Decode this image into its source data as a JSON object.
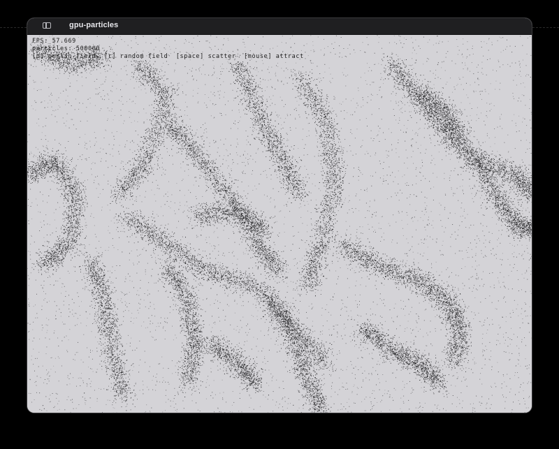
{
  "window": {
    "title": "gpu-particles",
    "sidebar_icon": "sidebar-toggle-icon"
  },
  "hud": {
    "fps": "FPS: 57.669",
    "particles": "particles: 500000",
    "controls": "[p] perlin field  [r] random field  [space] scatter  [mouse] attract"
  },
  "colors": {
    "background": "#000000",
    "titlebar": "#1f1f21",
    "canvas": "#d4d3d7",
    "particle": "#1a1a1a"
  }
}
